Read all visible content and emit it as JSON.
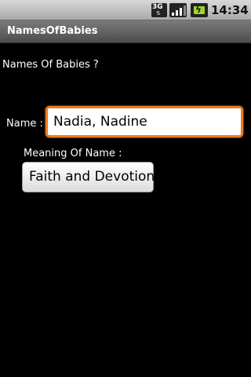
{
  "status_bar": {
    "network_label": "3G",
    "network_icon": "network-3g-icon",
    "signal_icon": "signal-strength-icon",
    "battery_icon": "battery-charging-icon",
    "time": "14:34"
  },
  "title_bar": {
    "title": "NamesOfBabies"
  },
  "form": {
    "question": "Names Of Babies ?",
    "name_label": "Name :",
    "name_value": "Nadia, Nadine",
    "meaning_label": "Meaning Of Name :",
    "meaning_value": "Faith and Devotion"
  },
  "colors": {
    "background": "#000000",
    "focus_border": "#f27b1a",
    "battery": "#9cd52b"
  }
}
